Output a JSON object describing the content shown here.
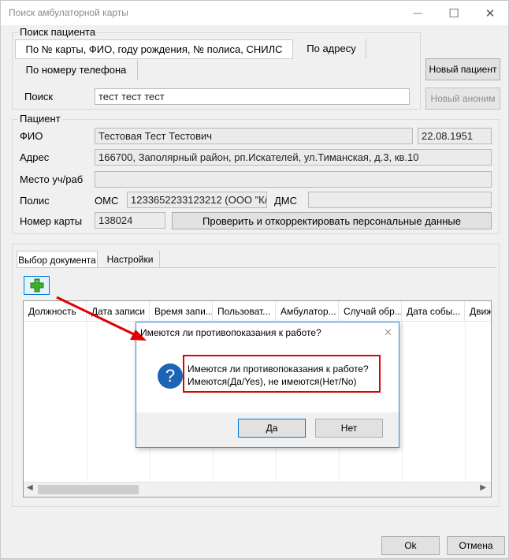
{
  "window": {
    "title": "Поиск амбулаторной карты",
    "minimize_glyph": "—",
    "maximize_glyph": "☐",
    "close_glyph": "✕"
  },
  "search": {
    "group_title": "Поиск пациента",
    "tabs": [
      {
        "label": "По № карты, ФИО, году рождения, № полиса, СНИЛС",
        "selected": true
      },
      {
        "label": "По адресу",
        "selected": false
      },
      {
        "label": "По номеру телефона",
        "selected": false
      }
    ],
    "query_label": "Поиск",
    "query_value": "тест тест тест",
    "new_patient_button": "Новый пациент",
    "new_anonymous_button": "Новый аноним"
  },
  "patient": {
    "group_title": "Пациент",
    "fio_label": "ФИО",
    "fio_value": "Тестовая Тест Тестович",
    "birth_date": "22.08.1951",
    "address_label": "Адрес",
    "address_value": "166700, Заполярный район, рп.Искателей, ул.Тиманская, д.3, кв.10",
    "workplace_label": "Место уч/раб",
    "workplace_value": "",
    "policy_label": "Полис",
    "oms_label": "ОМС",
    "oms_value": "1233652233123212 (ООО \"К/",
    "dms_label": "ДМС",
    "dms_value": "",
    "card_label": "Номер карты",
    "card_value": "138024",
    "verify_button": "Проверить и откорректировать персональные данные"
  },
  "docs": {
    "tabs": [
      {
        "label": "Выбор документа",
        "selected": true
      },
      {
        "label": "Настройки",
        "selected": false
      }
    ],
    "columns": [
      "Должность",
      "Дата записи",
      "Время запи...",
      "Пользоват...",
      "Амбулатор...",
      "Случай обр...",
      "Дата собы...",
      "Движ"
    ]
  },
  "dialog": {
    "title": "Имеются ли противопоказания к работе?",
    "line1": "Имеются ли противопоказания к работе?",
    "line2": "Имеются(Да/Yes), не имеются(Нет/No)",
    "yes_button": "Да",
    "no_button": "Нет",
    "close_glyph": "✕",
    "question_glyph": "?"
  },
  "footer": {
    "ok_button": "Ok",
    "cancel_button": "Отмена"
  },
  "colors": {
    "accent": "#0078d7",
    "annotation_red": "#e00000",
    "add_icon_green": "#3cb22b"
  }
}
